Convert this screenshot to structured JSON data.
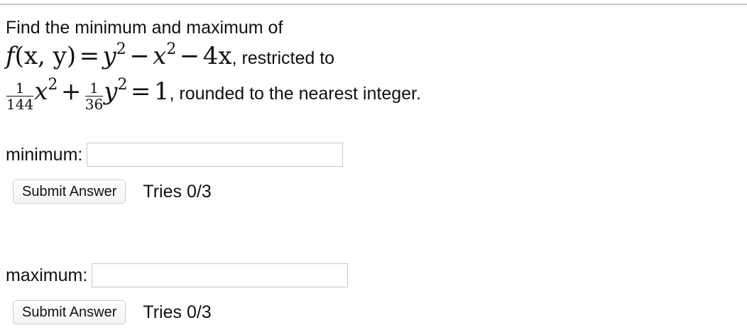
{
  "problem": {
    "prompt": "Find the minimum and maximum of",
    "f_name": "f",
    "f_args": "(x, y)",
    "equals": "=",
    "y_var": "y",
    "x_var": "x",
    "exp_2": "2",
    "minus": "−",
    "term_4x": "4x",
    "restricted_to": ", restricted to",
    "frac_1_num": "1",
    "frac_1_den": "144",
    "plus": "+",
    "frac_2_num": "1",
    "frac_2_den": "36",
    "one": "1",
    "suffix": ", rounded to the nearest integer."
  },
  "fields": [
    {
      "label": "minimum:",
      "value": "",
      "submit_label": "Submit Answer",
      "tries": "Tries 0/3"
    },
    {
      "label": "maximum:",
      "value": "",
      "submit_label": "Submit Answer",
      "tries": "Tries 0/3"
    }
  ]
}
